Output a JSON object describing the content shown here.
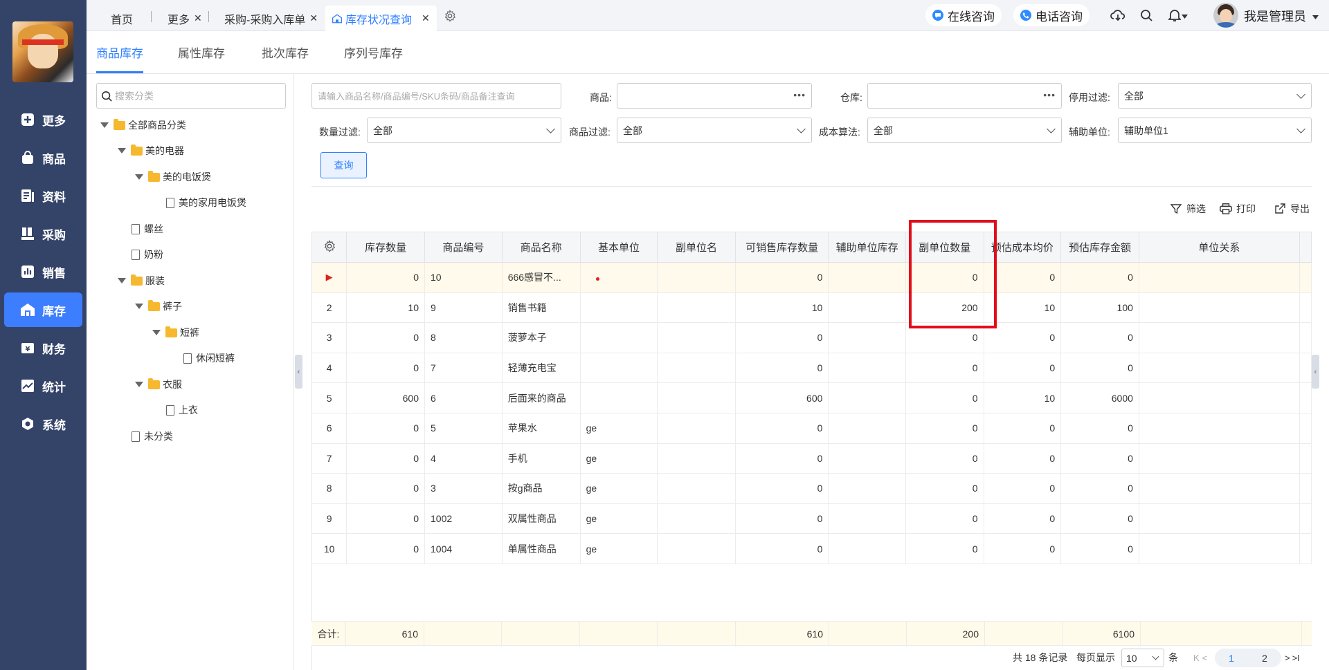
{
  "sidebar": {
    "items": [
      {
        "label": "更多",
        "icon": "plus-square-icon"
      },
      {
        "label": "商品",
        "icon": "bag-icon"
      },
      {
        "label": "资料",
        "icon": "document-icon"
      },
      {
        "label": "采购",
        "icon": "purchase-icon"
      },
      {
        "label": "销售",
        "icon": "chart-bar-icon"
      },
      {
        "label": "库存",
        "icon": "warehouse-icon",
        "active": true
      },
      {
        "label": "财务",
        "icon": "yen-icon"
      },
      {
        "label": "统计",
        "icon": "line-chart-icon"
      },
      {
        "label": "系统",
        "icon": "hexagon-icon"
      }
    ]
  },
  "tabs": {
    "home": "首页",
    "more": "更多",
    "purchase_in": "采购-采购入库单",
    "inventory_query": "库存状况查询",
    "close": "✕"
  },
  "header": {
    "online_consult": "在线咨询",
    "phone_consult": "电话咨询",
    "user_name": "我是管理员"
  },
  "subtabs": [
    "商品库存",
    "属性库存",
    "批次库存",
    "序列号库存"
  ],
  "tree": {
    "search_placeholder": "搜索分类",
    "nodes": [
      {
        "label": "全部商品分类"
      },
      {
        "label": "美的电器"
      },
      {
        "label": "美的电饭煲"
      },
      {
        "label": "美的家用电饭煲"
      },
      {
        "label": "螺丝"
      },
      {
        "label": "奶粉"
      },
      {
        "label": "服装"
      },
      {
        "label": "裤子"
      },
      {
        "label": "短裤"
      },
      {
        "label": "休闲短裤"
      },
      {
        "label": "衣服"
      },
      {
        "label": "上衣"
      },
      {
        "label": "未分类"
      }
    ]
  },
  "filters": {
    "keyword_placeholder": "请输入商品名称/商品编号/SKU条码/商品备注查询",
    "product_label": "商品:",
    "warehouse_label": "仓库:",
    "disabled_filter_label": "停用过滤:",
    "disabled_filter_value": "全部",
    "qty_filter_label": "数量过滤:",
    "qty_filter_value": "全部",
    "product_filter_label": "商品过滤:",
    "product_filter_value": "全部",
    "cost_method_label": "成本算法:",
    "cost_method_value": "全部",
    "aux_unit_label": "辅助单位:",
    "aux_unit_value": "辅助单位1",
    "query_button": "查询"
  },
  "toolbar": {
    "filter": "筛选",
    "print": "打印",
    "export": "导出"
  },
  "table": {
    "columns": [
      "库存数量",
      "商品编号",
      "商品名称",
      "基本单位",
      "副单位名",
      "可销售库存数量",
      "辅助单位库存",
      "副单位数量",
      "预估成本均价",
      "预估库存金额",
      "单位关系"
    ],
    "rows": [
      {
        "idx": "▶",
        "qty": "0",
        "code": "10",
        "name": "666感冒不...",
        "unit": "",
        "sub_unit": "",
        "sellable": "0",
        "aux_stock": "",
        "sub_qty": "0",
        "avg_cost": "0",
        "amount": "0",
        "relation": ""
      },
      {
        "idx": "2",
        "qty": "10",
        "code": "9",
        "name": "销售书籍",
        "unit": "",
        "sub_unit": "",
        "sellable": "10",
        "aux_stock": "",
        "sub_qty": "200",
        "avg_cost": "10",
        "amount": "100",
        "relation": ""
      },
      {
        "idx": "3",
        "qty": "0",
        "code": "8",
        "name": "菠萝本子",
        "unit": "",
        "sub_unit": "",
        "sellable": "0",
        "aux_stock": "",
        "sub_qty": "0",
        "avg_cost": "0",
        "amount": "0",
        "relation": ""
      },
      {
        "idx": "4",
        "qty": "0",
        "code": "7",
        "name": "轻薄充电宝",
        "unit": "",
        "sub_unit": "",
        "sellable": "0",
        "aux_stock": "",
        "sub_qty": "0",
        "avg_cost": "0",
        "amount": "0",
        "relation": ""
      },
      {
        "idx": "5",
        "qty": "600",
        "code": "6",
        "name": "后面来的商品",
        "unit": "",
        "sub_unit": "",
        "sellable": "600",
        "aux_stock": "",
        "sub_qty": "0",
        "avg_cost": "10",
        "amount": "6000",
        "relation": ""
      },
      {
        "idx": "6",
        "qty": "0",
        "code": "5",
        "name": "苹果水",
        "unit": "ge",
        "sub_unit": "",
        "sellable": "0",
        "aux_stock": "",
        "sub_qty": "0",
        "avg_cost": "0",
        "amount": "0",
        "relation": ""
      },
      {
        "idx": "7",
        "qty": "0",
        "code": "4",
        "name": "手机",
        "unit": "ge",
        "sub_unit": "",
        "sellable": "0",
        "aux_stock": "",
        "sub_qty": "0",
        "avg_cost": "0",
        "amount": "0",
        "relation": ""
      },
      {
        "idx": "8",
        "qty": "0",
        "code": "3",
        "name": "按g商品",
        "unit": "ge",
        "sub_unit": "",
        "sellable": "0",
        "aux_stock": "",
        "sub_qty": "0",
        "avg_cost": "0",
        "amount": "0",
        "relation": ""
      },
      {
        "idx": "9",
        "qty": "0",
        "code": "1002",
        "name": "双属性商品",
        "unit": "ge",
        "sub_unit": "",
        "sellable": "0",
        "aux_stock": "",
        "sub_qty": "0",
        "avg_cost": "0",
        "amount": "0",
        "relation": ""
      },
      {
        "idx": "10",
        "qty": "0",
        "code": "1004",
        "name": "单属性商品",
        "unit": "ge",
        "sub_unit": "",
        "sellable": "0",
        "aux_stock": "",
        "sub_qty": "0",
        "avg_cost": "0",
        "amount": "0",
        "relation": ""
      }
    ],
    "summary": {
      "label": "合计:",
      "qty": "610",
      "sellable": "610",
      "sub_qty": "200",
      "amount": "6100"
    }
  },
  "pager": {
    "total_text": "共 18 条记录",
    "per_page_label": "每页显示",
    "per_page_value": "10",
    "unit": "条",
    "pages": [
      "1",
      "2"
    ],
    "first": "K",
    "prev": "<",
    "next": ">",
    "last": ">I"
  },
  "colors": {
    "sidebar_bg": "#344469",
    "accent": "#2f7fff",
    "highlight_box": "#e10d1a"
  }
}
